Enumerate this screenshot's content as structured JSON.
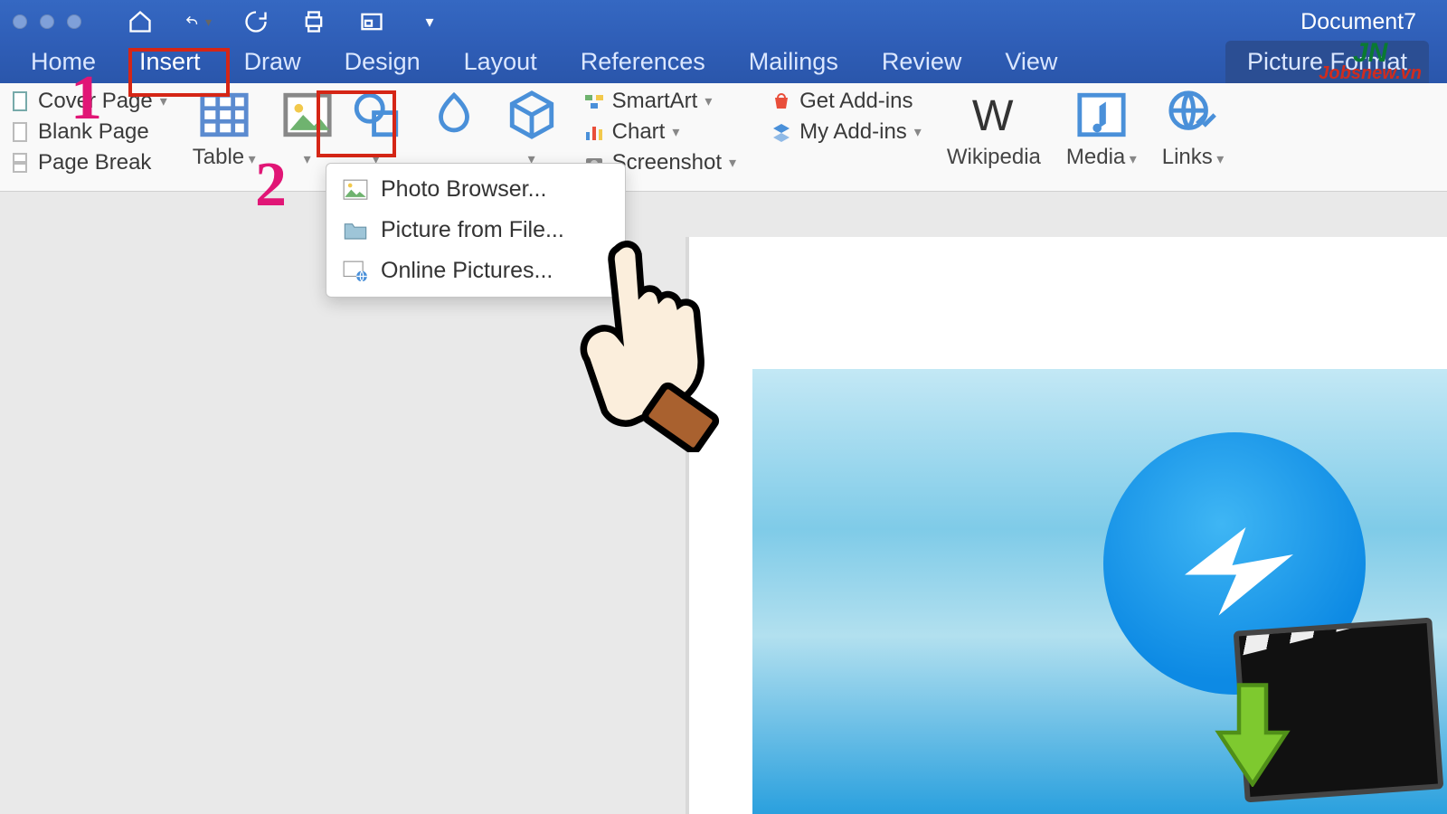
{
  "titlebar": {
    "document_name": "Document7"
  },
  "tabs": {
    "items": [
      "Home",
      "Insert",
      "Draw",
      "Design",
      "Layout",
      "References",
      "Mailings",
      "Review",
      "View"
    ],
    "context": "Picture Format",
    "active_index": 1
  },
  "ribbon": {
    "pages": {
      "cover": "Cover Page",
      "blank": "Blank Page",
      "break": "Page Break"
    },
    "table": "Table",
    "illustrations": {
      "smartart": "SmartArt",
      "chart": "Chart",
      "screenshot": "Screenshot"
    },
    "addins": {
      "get": "Get Add-ins",
      "my": "My Add-ins"
    },
    "wikipedia": "Wikipedia",
    "media": "Media",
    "links": "Links"
  },
  "dropdown": {
    "photo_browser": "Photo Browser...",
    "picture_from_file": "Picture from File...",
    "online_pictures": "Online Pictures..."
  },
  "annotations": {
    "step1": "1",
    "step2": "2"
  },
  "watermark": {
    "line1": "JN",
    "line2": "Jobsnew.vn"
  }
}
